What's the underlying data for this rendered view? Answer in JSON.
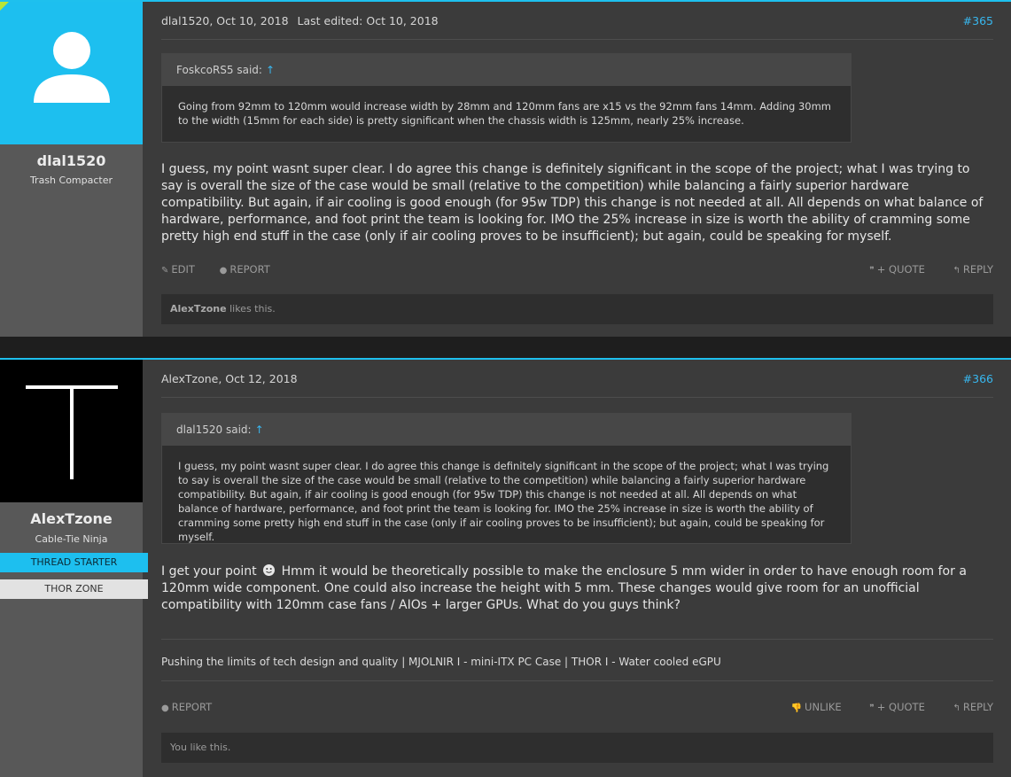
{
  "posts": [
    {
      "username": "dlal1520",
      "user_title": "Trash Compacter",
      "date": "dlal1520, Oct 10, 2018",
      "edited": "Last edited: Oct 10, 2018",
      "number": "#365",
      "quote": {
        "author": "FoskcoRS5 said:",
        "arrow": "↑",
        "text": "Going from 92mm to 120mm would increase width by 28mm and 120mm fans are x15 vs the 92mm fans 14mm. Adding 30mm to the width (15mm for each side) is pretty significant when the chassis width is 125mm, nearly 25% increase."
      },
      "message": "I guess, my point wasnt super clear. I do agree this change is definitely significant in the scope of the project; what I was trying to say is overall the size of the case would be small (relative to the competition) while balancing a fairly superior hardware compatibility. But again, if air cooling is good enough (for 95w TDP) this change is not needed at all. All depends on what balance of hardware, performance, and foot print the team is looking for. IMO the 25% increase in size is worth the ability of cramming some pretty high end stuff in the case (only if air cooling proves to be insufficient); but again, could be speaking for myself.",
      "controls": {
        "edit": "EDIT",
        "report": "REPORT",
        "quote": "+ QUOTE",
        "reply": "REPLY"
      },
      "likes": {
        "name": "AlexTzone",
        "text": " likes this."
      }
    },
    {
      "username": "AlexTzone",
      "user_title": "Cable-Tie Ninja",
      "ribbon_starter": "THREAD STARTER",
      "ribbon_zone": "THOR ZONE",
      "date": "AlexTzone, Oct 12, 2018",
      "number": "#366",
      "quote": {
        "author": "dlal1520 said:",
        "arrow": "↑",
        "text": "I guess, my point wasnt super clear. I do agree this change is definitely significant in the scope of the project; what I was trying to say is overall the size of the case would be small (relative to the competition) while balancing a fairly superior hardware compatibility. But again, if air cooling is good enough (for 95w TDP) this change is not needed at all. All depends on what balance of hardware, performance, and foot print the team is looking for. IMO the 25% increase in size is worth the ability of cramming some pretty high end stuff in the case (only if air cooling proves to be insufficient); but again, could be speaking for myself."
      },
      "message_a": "I get your point",
      "message_b": "Hmm it would be theoretically possible to make the enclosure 5 mm wider in order to have enough room for a 120mm wide component. One could also increase the height with 5 mm. These changes would give room for an unofficial compatibility with 120mm case fans / AIOs + larger GPUs. What do you guys think?",
      "signature": "Pushing the limits of tech design and quality | MJOLNIR I - mini-ITX PC Case | THOR I - Water cooled eGPU",
      "controls": {
        "report": "REPORT",
        "unlike": "UNLIKE",
        "quote": "+ QUOTE",
        "reply": "REPLY"
      },
      "likes": {
        "text": "You like this."
      }
    }
  ],
  "colors": {
    "accent": "#1dbfef",
    "link": "#38b8f0",
    "avatar1_bg": "#1dbfef",
    "avatar2_bg": "#000000"
  },
  "icons": [
    "default-user-icon",
    "edit-icon",
    "report-icon",
    "quote-icon",
    "reply-icon",
    "unlike-icon",
    "smile-icon"
  ]
}
